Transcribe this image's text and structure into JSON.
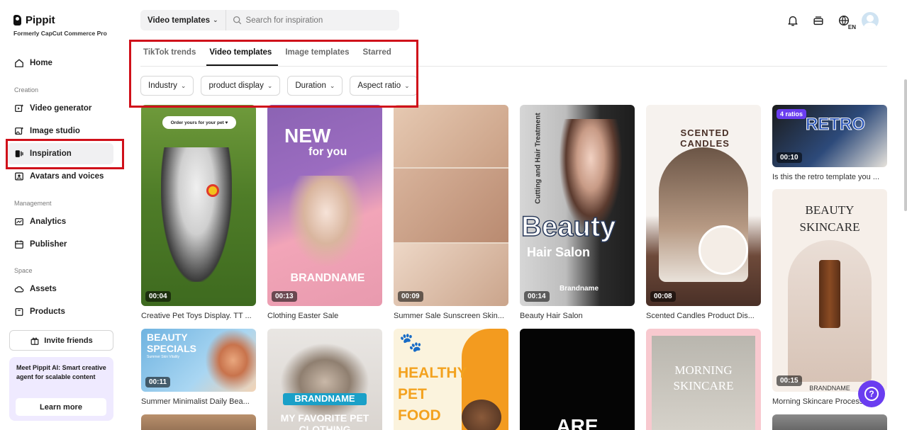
{
  "brand": {
    "name": "Pippit",
    "subtitle": "Formerly CapCut Commerce Pro"
  },
  "sidebar": {
    "home": "Home",
    "creation_label": "Creation",
    "creation_items": [
      "Video generator",
      "Image studio",
      "Inspiration",
      "Avatars and voices"
    ],
    "management_label": "Management",
    "management_items": [
      "Analytics",
      "Publisher"
    ],
    "space_label": "Space",
    "space_items": [
      "Assets",
      "Products"
    ],
    "invite_label": "Invite friends",
    "promo_text": "Meet Pippit AI: Smart creative agent for scalable content",
    "promo_button": "Learn more"
  },
  "search": {
    "type_selected": "Video templates",
    "placeholder": "Search for inspiration"
  },
  "header_icons": [
    "bell-icon",
    "inbox-icon",
    "globe-icon"
  ],
  "language_badge": "EN",
  "tabs": [
    "TikTok trends",
    "Video templates",
    "Image templates",
    "Starred"
  ],
  "active_tab": "Video templates",
  "filters": [
    "Industry",
    "product display",
    "Duration",
    "Aspect ratio"
  ],
  "cards": {
    "c1": {
      "duration": "00:04",
      "caption": "Creative Pet Toys Display. TT ...",
      "overlay": "Order yours for your pet ♥"
    },
    "c2": {
      "duration": "00:13",
      "caption": "Clothing Easter Sale",
      "headline": "NEW",
      "sub": "for you",
      "brand": "BRANDNAME"
    },
    "c3": {
      "duration": "00:09",
      "caption": "Summer Sale Sunscreen Skin..."
    },
    "c4": {
      "duration": "00:14",
      "caption": "Beauty Hair Salon",
      "vertical": "Cutting and Hair Treatment",
      "headline": "Beauty",
      "sub": "Hair Salon",
      "brand": "Brandname"
    },
    "c5": {
      "duration": "00:08",
      "caption": "Scented Candles Product Dis...",
      "headline": "SCENTED CANDLES"
    },
    "c6": {
      "duration": "00:10",
      "caption": "Is this the retro template you ...",
      "ratios": "4 ratios",
      "headline": "RETRO"
    },
    "c7": {
      "duration": "00:15",
      "caption": "Morning Skincare Process",
      "headline": "BEAUTY SKINCARE",
      "brand": "BRANDNAME"
    },
    "c8": {
      "duration": "00:11",
      "caption": "Summer Minimalist Daily Bea...",
      "headline": "BEAUTY SPECIALS",
      "sub": "Summer Skin Vitality"
    },
    "c9": {
      "brand": "BRANDNAME",
      "headline": "MY FAVORITE PET CLOTHING"
    },
    "c10": {
      "headline": "HEALTHY PET FOOD"
    },
    "c11": {
      "headline": "ARE"
    },
    "c12": {
      "headline": "MORNING SKINCARE"
    }
  },
  "colors": {
    "accent": "#6a3df0",
    "highlight_box": "#d0101a"
  }
}
